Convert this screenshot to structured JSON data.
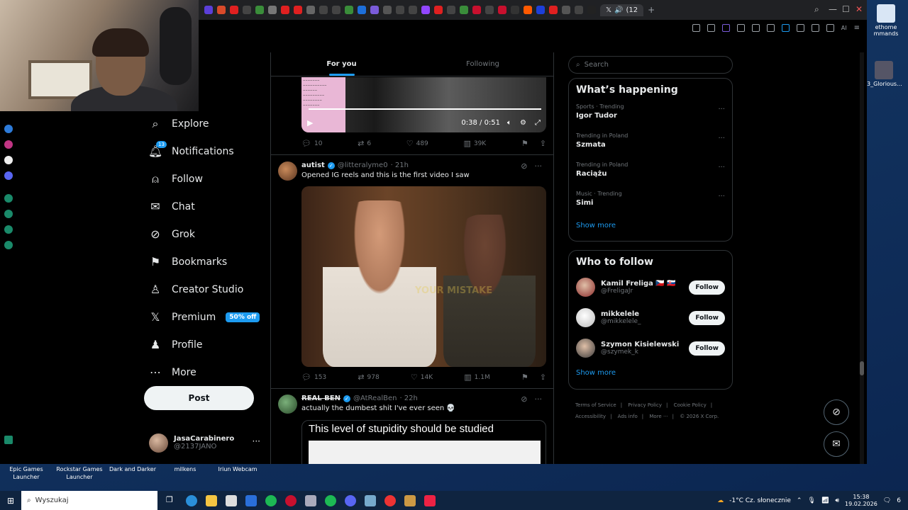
{
  "browser": {
    "active_tab": "(12",
    "colors": {
      "accent": "#1d9bf0",
      "bg": "#000000",
      "text": "#e7e9ea",
      "muted": "#71767b"
    }
  },
  "nav": {
    "items": [
      {
        "label": "Explore",
        "icon": "search-icon"
      },
      {
        "label": "Notifications",
        "icon": "bell-icon",
        "badge": "13"
      },
      {
        "label": "Follow",
        "icon": "person-plus-icon"
      },
      {
        "label": "Chat",
        "icon": "mail-icon"
      },
      {
        "label": "Grok",
        "icon": "grok-icon"
      },
      {
        "label": "Bookmarks",
        "icon": "bookmark-icon"
      },
      {
        "label": "Creator Studio",
        "icon": "creator-icon"
      },
      {
        "label": "Premium",
        "icon": "x-logo-icon",
        "pill": "50% off"
      },
      {
        "label": "Profile",
        "icon": "person-icon"
      },
      {
        "label": "More",
        "icon": "more-circle-icon"
      }
    ],
    "post_label": "Post",
    "account": {
      "name": "JasaCarabinero",
      "handle": "@2137JANO"
    }
  },
  "timeline": {
    "tabs": [
      "For you",
      "Following"
    ],
    "video": {
      "time": "0:38 / 0:51"
    },
    "tweet0_stats": {
      "replies": "10",
      "reposts": "6",
      "likes": "489",
      "views": "39K"
    },
    "tweet1": {
      "name": "autist",
      "handle": "@litteralyme0",
      "time": "· 21h",
      "text": "Opened IG reels and this is the first video I saw",
      "image_watermark": "YOUR MISTAKE",
      "stats": {
        "replies": "153",
        "reposts": "978",
        "likes": "14K",
        "views": "1.1M"
      }
    },
    "tweet2": {
      "name": "REAL BEN",
      "handle": "@AtRealBen",
      "time": "· 22h",
      "text": "actually the dumbest shit I've ever seen 💀",
      "image_caption": "This level of stupidity should be studied"
    }
  },
  "sidebar": {
    "search_placeholder": "Search",
    "happening_title": "What’s happening",
    "trends": [
      {
        "context": "Sports · Trending",
        "name": "Igor Tudor"
      },
      {
        "context": "Trending in Poland",
        "name": "Szmata"
      },
      {
        "context": "Trending in Poland",
        "name": "Raciążu"
      },
      {
        "context": "Music · Trending",
        "name": "Simi"
      }
    ],
    "show_more": "Show more",
    "who_title": "Who to follow",
    "who": [
      {
        "name": "Kamil Freliga 🇨🇿 🇸🇰",
        "handle": "@FreligaJr"
      },
      {
        "name": "mikkelele",
        "handle": "@mikkelele_"
      },
      {
        "name": "Szymon Kisielewski",
        "handle": "@szymek_k"
      }
    ],
    "follow_label": "Follow",
    "footer": [
      "Terms of Service",
      "|",
      "Privacy Policy",
      "|",
      "Cookie Policy",
      "|",
      "Accessibility",
      "|",
      "Ads info",
      "|",
      "More ···",
      "|",
      "© 2026 X Corp."
    ]
  },
  "desktop": {
    "right_icons": [
      "ethome mmands",
      "3_Glorious..."
    ],
    "bottom_labels": [
      "Epic Games Launcher",
      "Rockstar Games Launcher",
      "Dark and Darker",
      "milkens",
      "Iriun Webcam"
    ]
  },
  "taskbar": {
    "search_placeholder": "Wyszukaj",
    "weather": "-1°C  Cz. słonecznie",
    "time": "15:38",
    "date": "19.02.2026",
    "notif_count": "6"
  }
}
